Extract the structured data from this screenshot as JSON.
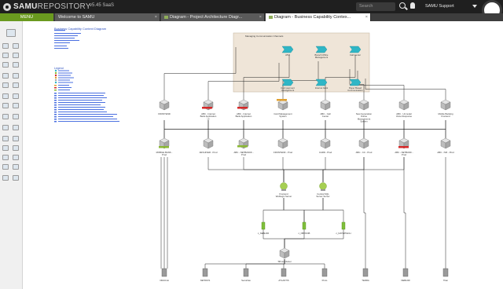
{
  "app": {
    "brand_bold": "SAMU",
    "brand_thin": "REPOSITORY",
    "version": "v5.45 SaaS",
    "search_placeholder": "Search",
    "user": "SAMU Support"
  },
  "tabs": {
    "menu_label": "MENU",
    "items": [
      {
        "label": "Welcome to SAMU"
      },
      {
        "label": "Diagram - Project Architecture Diagr..."
      },
      {
        "label": "Diagram - Business Capability Contex..."
      }
    ]
  },
  "doc": {
    "title": "Business Capability Context Diagram",
    "legend_title": "Legend"
  },
  "diagram": {
    "group_label": "Managing Communication Channels",
    "capabilities": [
      "ATM",
      "Branch Office Management",
      "Call Center",
      "Card payment management",
      "Internet bank",
      "Paper Based Communication"
    ],
    "app_row1": [
      "FRONTEND",
      "ABC - Internet Bank Application UI",
      "ABC - Internet Bank Application",
      "Card Management System",
      "ABC - Call Center",
      "New Generation Online Management System",
      "ABC - Unmodel Voice Response",
      "Mobile Banking Frontend"
    ],
    "app_row2": [
      "MOBILE BANK - Prod",
      "ARCHIVER - Prod",
      "ABC - NETBANKK - Prod",
      "FRONTEND - Prod",
      "CARD - Prod",
      "ABC - CC - Prod",
      "ABC - NETBANK - Prod",
      "ABC - IVR - Prod"
    ],
    "servers": [
      "Frontend Weblogic Server",
      "Central SQL Server Server"
    ],
    "services": [
      "c_NEBLDR",
      "c_NBYDOB",
      "c_NATIMTECH"
    ],
    "cluster": "TiPmio cluster",
    "databases": [
      "ORACLE",
      "NETIDOS",
      "Securitas",
      "ATLANTIS",
      "Proto",
      "TERRA",
      "NEBLDR",
      "Titan"
    ],
    "flags": [
      "Not approved",
      "Not approved",
      "Not approved",
      "Not approved",
      "Approved",
      "Approved",
      "Not approved"
    ]
  },
  "colors": {
    "topbar": "#1f1f1f",
    "menu": "#6a9a1f",
    "capability": "#2fb6c6",
    "group_fill": "#efe5d8",
    "flag_red": "#d62828",
    "flag_green": "#8ab833",
    "node": "#c8c8c8"
  }
}
